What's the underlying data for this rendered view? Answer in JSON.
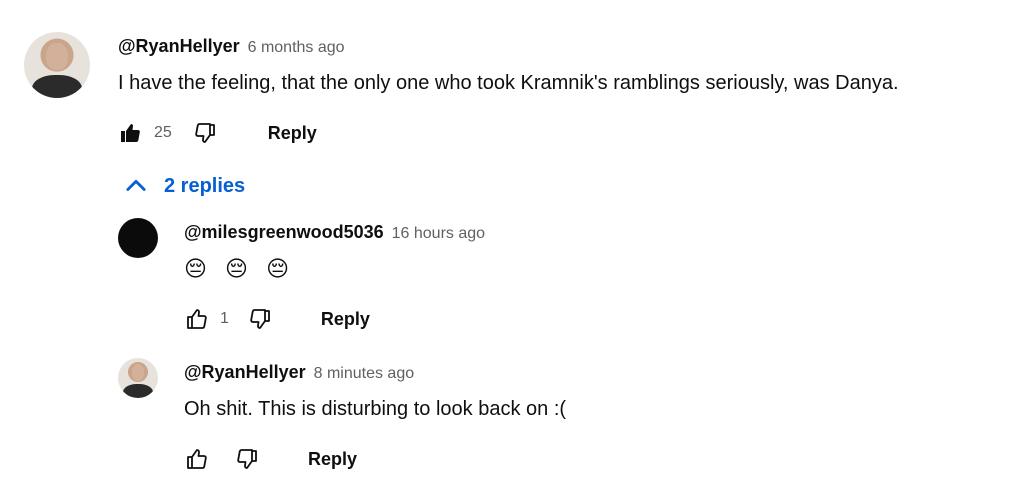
{
  "comments": [
    {
      "author": "@RyanHellyer",
      "time": "6 months ago",
      "text": "I have the feeling, that the only one who took Kramnik's ramblings seriously, was Danya.",
      "like_count": "25",
      "reply_label": "Reply",
      "replies_toggle": "2 replies"
    }
  ],
  "replies": [
    {
      "author": "@milesgreenwood5036",
      "time": "16 hours ago",
      "text": "😔 😔 😔",
      "like_count": "1",
      "reply_label": "Reply"
    },
    {
      "author": "@RyanHellyer",
      "time": "8 minutes ago",
      "text": "Oh shit. This is disturbing to look back on :(",
      "like_count": "",
      "reply_label": "Reply"
    }
  ],
  "colors": {
    "link": "#065fd4",
    "text": "#0f0f0f",
    "secondary": "#606060"
  },
  "icons": {
    "like": "thumb-up-icon",
    "like_filled": "thumb-up-filled-icon",
    "dislike": "thumb-down-icon",
    "collapse": "chevron-up-icon"
  }
}
